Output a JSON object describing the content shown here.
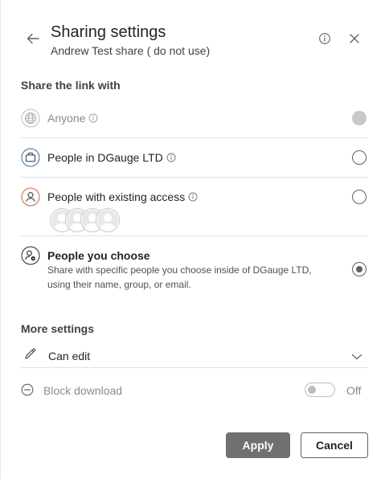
{
  "header": {
    "title": "Sharing settings",
    "subtitle": "Andrew Test share ( do not use)",
    "icons": {
      "back": "arrow-left-icon",
      "info": "info-icon",
      "close": "close-icon"
    }
  },
  "share_section": {
    "label": "Share the link with",
    "options": [
      {
        "id": "anyone",
        "label": "Anyone",
        "icon": "globe-icon",
        "has_info": true,
        "state": "disabled"
      },
      {
        "id": "org",
        "label": "People in DGauge LTD",
        "icon": "briefcase-icon",
        "has_info": true,
        "state": "unselected"
      },
      {
        "id": "existing",
        "label": "People with existing access",
        "icon": "person-icon",
        "has_info": true,
        "state": "unselected",
        "avatar_count": 4
      },
      {
        "id": "choose",
        "label": "People you choose",
        "icon": "person-settings-icon",
        "state": "selected",
        "description_line1": "Share with specific people you choose inside of DGauge LTD,",
        "description_line2": "using their name, group, or email."
      }
    ]
  },
  "more_settings": {
    "label": "More settings",
    "permission": {
      "label": "Can edit",
      "icon": "pencil-icon",
      "dropdown_icon": "chevron-down-icon"
    },
    "block_download": {
      "label": "Block download",
      "icon": "minus-circle-icon",
      "toggle_state": "Off",
      "enabled": false
    }
  },
  "footer": {
    "apply_label": "Apply",
    "cancel_label": "Cancel"
  },
  "colors": {
    "apply_bg": "#707070",
    "org_icon": "#2b6cb0",
    "existing_icon": "#c0693f",
    "disabled_text": "#8a8a8a"
  }
}
